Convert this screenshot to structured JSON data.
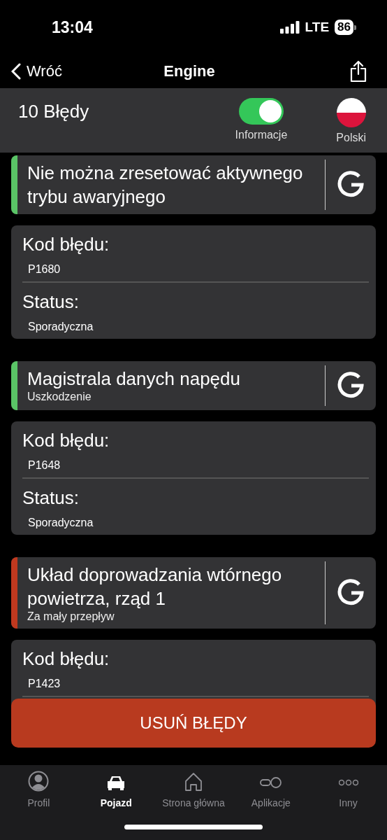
{
  "status_bar": {
    "time": "13:04",
    "network": "LTE",
    "battery": "86"
  },
  "nav": {
    "back": "Wróć",
    "title": "Engine"
  },
  "header": {
    "count": "10 Błędy",
    "toggle": {
      "label": "Informacje",
      "on": true
    },
    "language": {
      "label": "Polski"
    }
  },
  "errors": [
    {
      "title": "Nie można zresetować aktywnego trybu awaryjnego",
      "color": "#5ac466",
      "code_label": "Kod błędu:",
      "code": "P1680",
      "status_label": "Status:",
      "status": "Sporadyczna"
    },
    {
      "title": "Magistrala danych napędu",
      "subtitle": "Uszkodzenie",
      "color": "#5ac466",
      "code_label": "Kod błędu:",
      "code": "P1648",
      "status_label": "Status:",
      "status": "Sporadyczna"
    },
    {
      "title": "Układ doprowadzania wtórnego powietrza, rząd 1",
      "subtitle": "Za mały przepływ",
      "color": "#c0391f",
      "code_label": "Kod błędu:",
      "code": "P1423"
    }
  ],
  "clear_button": "USUŃ BŁĘDY",
  "tabs": [
    {
      "label": "Profil",
      "kind": "person",
      "selected": false
    },
    {
      "label": "Pojazd",
      "kind": "car",
      "selected": true
    },
    {
      "label": "Strona główna",
      "kind": "home",
      "selected": false
    },
    {
      "label": "Aplikacje",
      "kind": "apps",
      "selected": false
    },
    {
      "label": "Inny",
      "kind": "more",
      "selected": false
    }
  ]
}
